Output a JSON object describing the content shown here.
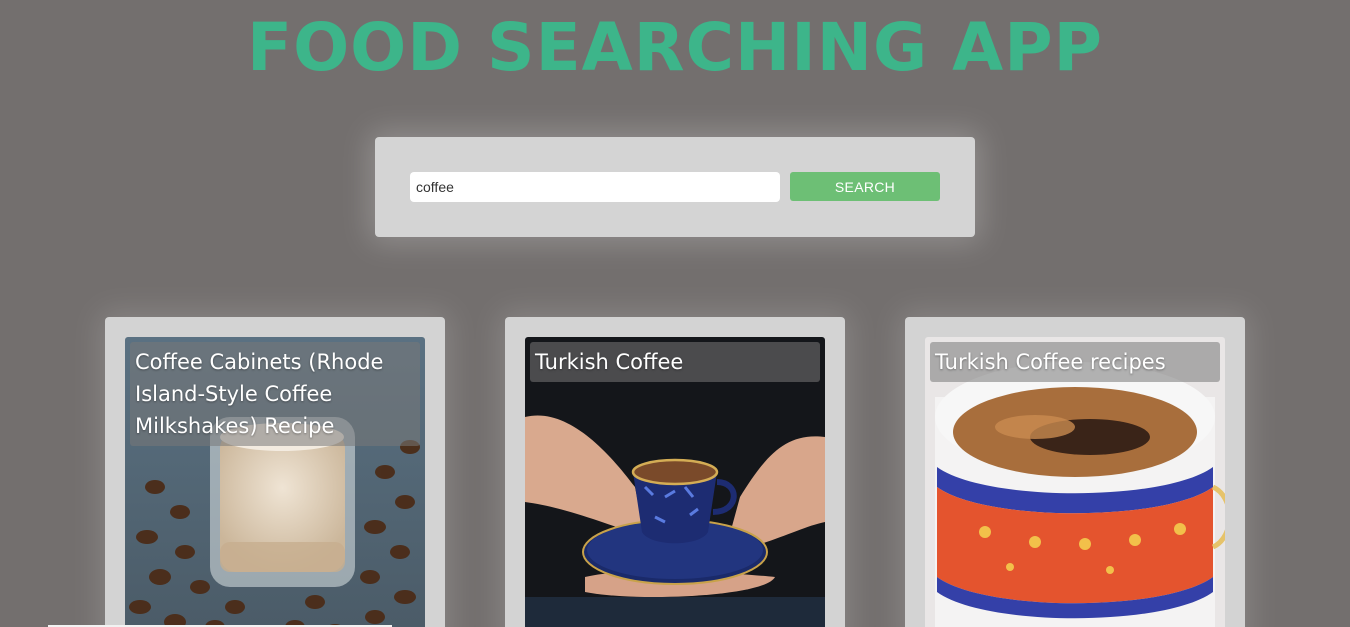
{
  "header": {
    "title": "FOOD SEARCHING APP"
  },
  "search": {
    "value": "coffee",
    "button_label": "SEARCH"
  },
  "results": [
    {
      "title": "Coffee Cabinets (Rhode Island-Style Coffee Milkshakes) Recipe",
      "image": "coffee-milkshake-with-beans"
    },
    {
      "title": "Turkish Coffee",
      "image": "hands-holding-turkish-coffee-cup"
    },
    {
      "title": "Turkish Coffee recipes",
      "image": "turkish-coffee-in-red-patterned-cup"
    }
  ],
  "colors": {
    "background": "#736f6e",
    "title": "#3db58a",
    "panel": "#d4d4d4",
    "button": "#6dbf75"
  }
}
